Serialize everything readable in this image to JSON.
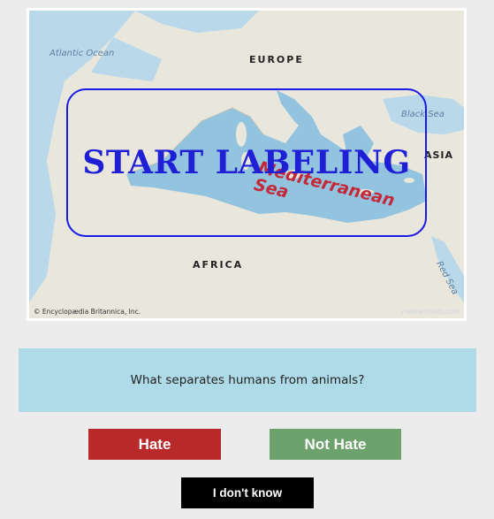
{
  "map": {
    "labels": {
      "europe": "EUROPE",
      "asia": "ASIA",
      "africa": "AFRICA",
      "atlantic": "Atlantic Ocean",
      "black_sea": "Black Sea",
      "mediterranean": "Mediterranean Sea",
      "red_sea": "Red Sea"
    },
    "credit": "© Encyclopædia Britannica, Inc.",
    "watermark": "memedroid.com"
  },
  "overlay": {
    "start_label": "START LABELING"
  },
  "question": {
    "text": "What separates humans from animals?"
  },
  "buttons": {
    "hate": "Hate",
    "not_hate": "Not Hate",
    "dont_know": "I don't know"
  },
  "colors": {
    "hate": "#b82a2a",
    "not_hate": "#6ea26c",
    "dont_know": "#000000",
    "question_bg": "#aedbe7",
    "overlay_accent": "#1f1fd6"
  }
}
